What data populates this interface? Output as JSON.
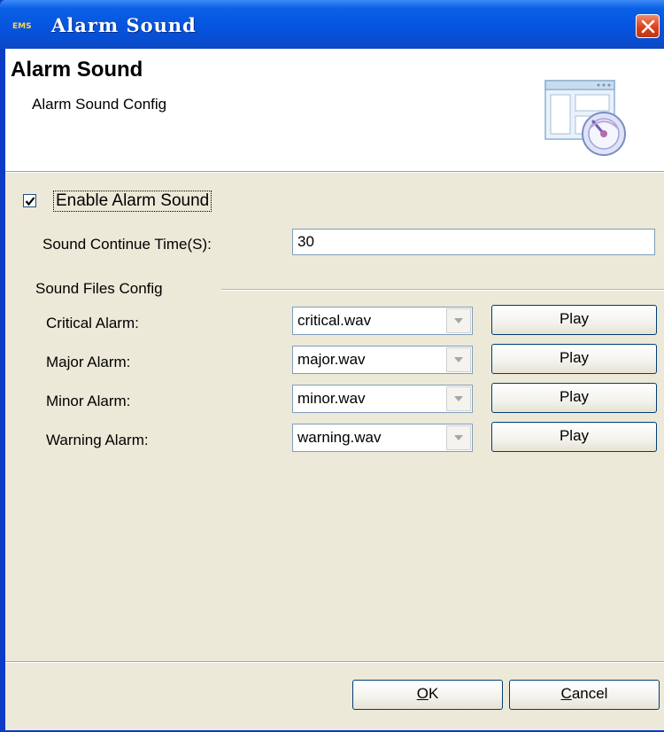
{
  "window": {
    "badge": "EMS",
    "title": "Alarm Sound"
  },
  "header": {
    "title": "Alarm Sound",
    "subtitle": "Alarm Sound Config",
    "icon": "settings-window-gauge-icon"
  },
  "enable": {
    "label": "Enable Alarm Sound",
    "checked": true
  },
  "continue_time": {
    "label": "Sound Continue Time(S):",
    "value": "30"
  },
  "group": {
    "label": "Sound Files Config"
  },
  "alarms": [
    {
      "label": "Critical Alarm:",
      "file": "critical.wav",
      "play": "Play"
    },
    {
      "label": "Major Alarm:",
      "file": "major.wav",
      "play": "Play"
    },
    {
      "label": "Minor Alarm:",
      "file": "minor.wav",
      "play": "Play"
    },
    {
      "label": "Warning Alarm:",
      "file": "warning.wav",
      "play": "Play"
    }
  ],
  "buttons": {
    "ok_mnemonic": "O",
    "ok_rest": "K",
    "cancel_mnemonic": "C",
    "cancel_rest": "ancel"
  },
  "colors": {
    "titlebar": "#0553de",
    "dialog_bg": "#ece9d8",
    "close": "#d8431e"
  }
}
